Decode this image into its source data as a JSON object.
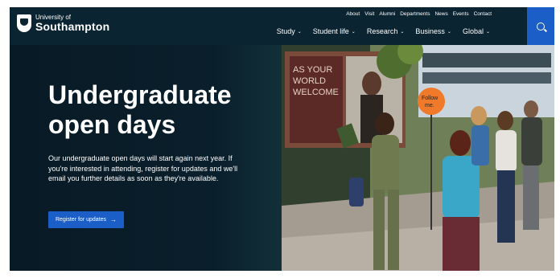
{
  "brand": {
    "line1": "University of",
    "line2": "Southampton"
  },
  "utility_nav": [
    "About",
    "Visit",
    "Alumni",
    "Departments",
    "News",
    "Events",
    "Contact"
  ],
  "main_nav": [
    {
      "label": "Study"
    },
    {
      "label": "Student life"
    },
    {
      "label": "Research"
    },
    {
      "label": "Business"
    },
    {
      "label": "Global"
    }
  ],
  "hero": {
    "title_line1": "Undergraduate",
    "title_line2": "open days",
    "body": "Our undergraduate open days will start again next year. If you're interested in attending, register for updates and we'll email you further details as soon as they're available.",
    "cta_label": "Register for updates",
    "cta_icon": "arrow-right-icon"
  },
  "photo": {
    "poster_text": "AS YOUR WORLD WELCOME",
    "sign_text": "Follow me."
  },
  "colors": {
    "header_bg": "#0b2431",
    "hero_bg": "#0a1f2c",
    "accent": "#1c5ec7",
    "sign": "#f07a2a"
  }
}
